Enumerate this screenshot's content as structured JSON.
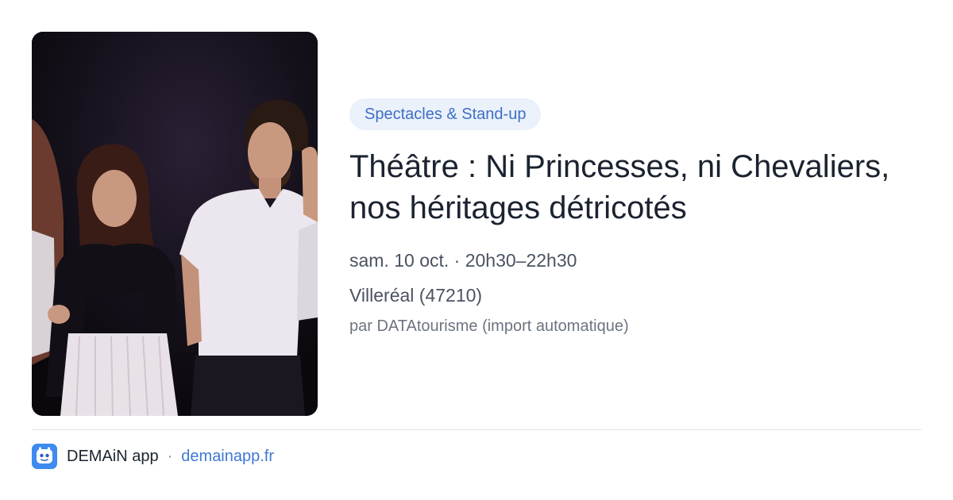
{
  "event": {
    "category": "Spectacles & Stand-up",
    "title": "Théâtre : Ni Princesses, ni Chevaliers, nos héritages détricotés",
    "datetime": "sam. 10 oct. · 20h30–22h30",
    "location": "Villeréal (47210)",
    "source": "par DATAtourisme (import automatique)"
  },
  "footer": {
    "app_name": "DEMAiN app",
    "separator": "·",
    "link": "demainapp.fr"
  },
  "icons": {
    "app": "demain-app-icon"
  },
  "colors": {
    "chip_bg": "#eaf1fb",
    "chip_text": "#3f6fc3",
    "title": "#1b2330",
    "link": "#3f78d4",
    "app_icon": "#3d8bef"
  }
}
